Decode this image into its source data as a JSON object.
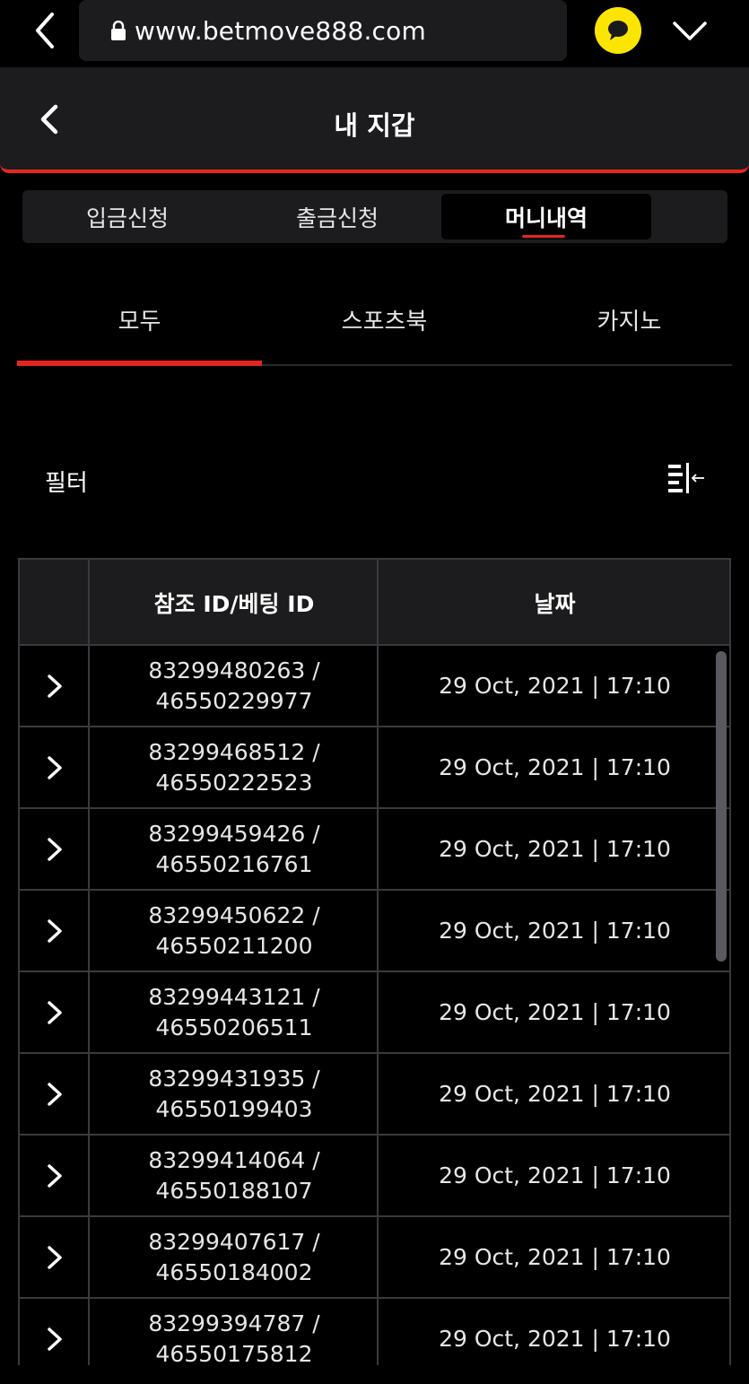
{
  "browser": {
    "url": "www.betmove888.com",
    "icons": [
      "back-chevron-icon",
      "lock-icon",
      "chat-bubble-icon",
      "chevron-down-icon"
    ],
    "accent": "#fce500"
  },
  "header": {
    "title": "내 지갑"
  },
  "segments": [
    {
      "label": "입금신청"
    },
    {
      "label": "출금신청"
    },
    {
      "label": "머니내역",
      "active": true
    }
  ],
  "tabs": [
    {
      "label": "모두",
      "active": true
    },
    {
      "label": "스포츠북"
    },
    {
      "label": "카지노"
    }
  ],
  "filter": {
    "label": "필터"
  },
  "table": {
    "headers": [
      "참조 ID/베팅 ID",
      "날짜"
    ],
    "rows": [
      {
        "ref": "83299480263 /",
        "bet": "46550229977",
        "date": "29 Oct, 2021 | 17:10"
      },
      {
        "ref": "83299468512 /",
        "bet": "46550222523",
        "date": "29 Oct, 2021 | 17:10"
      },
      {
        "ref": "83299459426 /",
        "bet": "46550216761",
        "date": "29 Oct, 2021 | 17:10"
      },
      {
        "ref": "83299450622 /",
        "bet": "46550211200",
        "date": "29 Oct, 2021 | 17:10"
      },
      {
        "ref": "83299443121 /",
        "bet": "46550206511",
        "date": "29 Oct, 2021 | 17:10"
      },
      {
        "ref": "83299431935 /",
        "bet": "46550199403",
        "date": "29 Oct, 2021 | 17:10"
      },
      {
        "ref": "83299414064 /",
        "bet": "46550188107",
        "date": "29 Oct, 2021 | 17:10"
      },
      {
        "ref": "83299407617 /",
        "bet": "46550184002",
        "date": "29 Oct, 2021 | 17:10"
      },
      {
        "ref": "83299394787 /",
        "bet": "46550175812",
        "date": "29 Oct, 2021 | 17:10"
      }
    ]
  },
  "colors": {
    "accent": "#e5261f",
    "surface": "#1c1c1e",
    "background": "#000000"
  }
}
